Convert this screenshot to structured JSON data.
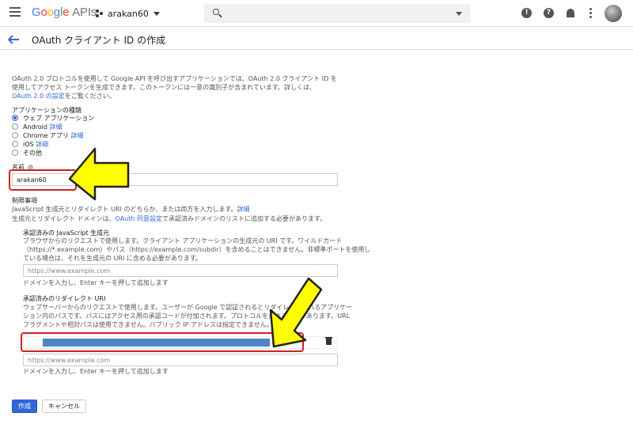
{
  "topbar": {
    "logo": {
      "g1": "G",
      "g2": "o",
      "g3": "o",
      "g4": "g",
      "g5": "l",
      "g6": "e",
      "apis": "APIs"
    },
    "project": "arakan60",
    "search_placeholder": ""
  },
  "header": {
    "title": "OAuth クライアント ID の作成"
  },
  "intro": {
    "line1": "OAuth 2.0 プロトコルを使用して Google API を呼び出すアプリケーションでは、OAuth 2.0 クライアント ID を",
    "line2": "使用してアクセス トークンを生成できます。このトークンには一意の識別子が含まれています。詳しくは、",
    "link": "OAuth 2.0 の設定",
    "link_suffix": "をご覧ください。"
  },
  "app_type": {
    "label": "アプリケーションの種類",
    "options": [
      {
        "label": "ウェブ アプリケーション",
        "detail": "",
        "selected": true
      },
      {
        "label": "Android",
        "detail": "詳細",
        "selected": false
      },
      {
        "label": "Chrome アプリ",
        "detail": "詳細",
        "selected": false
      },
      {
        "label": "iOS",
        "detail": "詳細",
        "selected": false
      },
      {
        "label": "その他",
        "detail": "",
        "selected": false
      }
    ]
  },
  "name_field": {
    "label": "名前",
    "value": "arakan60"
  },
  "restrictions": {
    "heading": "制限事項",
    "line1": "JavaScript 生成元とリダイレクト URI のどちらか、または両方を入力します。",
    "line1_link": "詳細",
    "line2_prefix": "生成元とリダイレクト ドメインは、",
    "line2_link": "OAuth 同意設定",
    "line2_suffix": "で承認済みドメインのリストに追加する必要があります。"
  },
  "js_origins": {
    "heading": "承認済みの JavaScript 生成元",
    "line1": "ブラウザからのリクエストで使用します。クライアント アプリケーションの生成元の URI です。ワイルドカード",
    "line2": "（https://*.example.com）やパス（https://example.com/subdir）を含めることはできません。非標準ポートを使用し",
    "line3": "ている場合は、それを生成元の URI に含める必要があります。",
    "placeholder": "https://www.example.com",
    "hint": "ドメインを入力し、Enter キーを押して追加します"
  },
  "redirect_uris": {
    "heading": "承認済みのリダイレクト URI",
    "line1": "ウェブサーバーからのリクエストで使用します。ユーザーが Google で認証されるとリダイレクトされるアプリケー",
    "line2": "ション内のパスです。パスにはアクセス用の承認コードが付加されます。プロトコルを含める必要があります。URL",
    "line3": "フラグメントや相対パスは使用できません。パブリック IP アドレスは指定できません。",
    "entry_suffix": "s",
    "placeholder": "https://www.example.com",
    "hint": "ドメインを入力し、Enter キーを押して追加します"
  },
  "actions": {
    "create": "作成",
    "cancel": "キャンセル"
  },
  "colors": {
    "accent": "#3367d6",
    "highlight": "#d32020",
    "arrow_fill": "#ffff00"
  }
}
